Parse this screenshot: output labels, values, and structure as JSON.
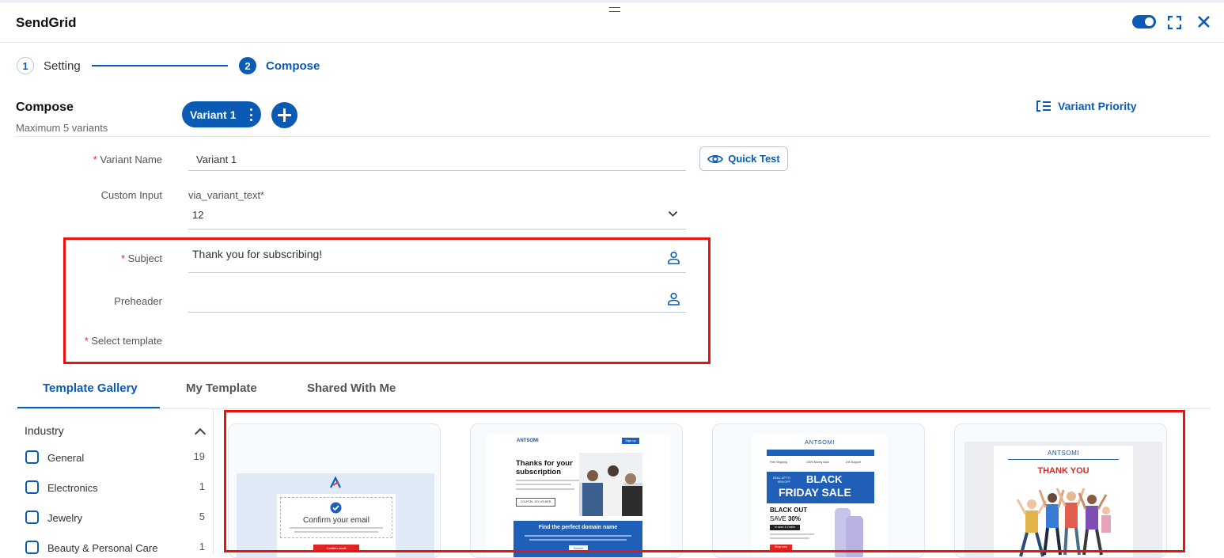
{
  "app": {
    "title": "SendGrid"
  },
  "stepper": {
    "steps": [
      {
        "number": "1",
        "label": "Setting"
      },
      {
        "number": "2",
        "label": "Compose"
      }
    ]
  },
  "compose": {
    "title": "Compose",
    "subtitle": "Maximum 5 variants",
    "variant_tab": "Variant 1",
    "variant_priority": "Variant Priority"
  },
  "form": {
    "variant_name_label": "Variant Name",
    "variant_name_value": "Variant 1",
    "quick_test": "Quick Test",
    "custom_input_label": "Custom Input",
    "custom_input_field_label": "via_variant_text*",
    "custom_input_value": "12",
    "subject_label": "Subject",
    "subject_value": "Thank you for subscribing!",
    "preheader_label": "Preheader",
    "preheader_value": "",
    "select_template_label": "Select template",
    "required_mark": "*"
  },
  "template_tabs": [
    "Template Gallery",
    "My Template",
    "Shared With Me"
  ],
  "filters": {
    "title": "Industry",
    "items": [
      {
        "label": "General",
        "count": "19"
      },
      {
        "label": "Electronics",
        "count": "1"
      },
      {
        "label": "Jewelry",
        "count": "5"
      },
      {
        "label": "Beauty & Personal Care",
        "count": "1"
      }
    ]
  },
  "templates": {
    "t1": {
      "heading": "Confirm your email",
      "button": "Confirm email"
    },
    "t2": {
      "brand": "ANTSOMI",
      "signup": "Sign up",
      "heading": "Thanks for your subscription",
      "coupon": "COUPON: JOY-JOLBER",
      "banner": "Find the perfect domain name",
      "button": "Search"
    },
    "t3": {
      "brand": "ANTSOMI",
      "nav": [
        "Free Shipping",
        "100% Money back",
        "24h Support"
      ],
      "deal": "DEAL UP TO 50% OFF",
      "banner_line1": "BLACK",
      "banner_line2": "FRIDAY SALE",
      "blackout": "BLACK OUT",
      "save_prefix": "SAVE",
      "save_pct": "30%",
      "instore": "In store & Online",
      "button": "Shop now"
    },
    "t4": {
      "brand": "ANTSOMI",
      "heading": "THANK YOU"
    }
  },
  "colors": {
    "brand_blue": "#0b5bb5",
    "highlight_red": "#ee1111",
    "required_red": "#e0261c"
  }
}
